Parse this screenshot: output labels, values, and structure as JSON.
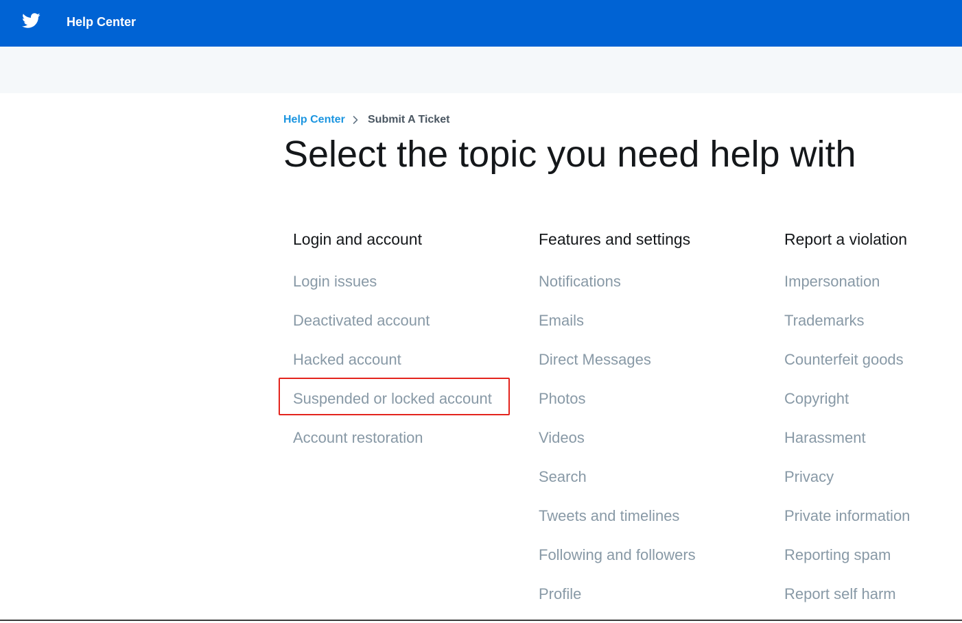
{
  "header": {
    "logo_icon": "twitter-bird-icon",
    "brand_label": "Help Center",
    "background_color": "#0063d4"
  },
  "breadcrumb": {
    "home_label": "Help Center",
    "separator_icon": "chevron-right-icon",
    "current_label": "Submit A Ticket"
  },
  "page": {
    "title": "Select the topic you need help with"
  },
  "topics": [
    {
      "heading": "Login and account",
      "items": [
        "Login issues",
        "Deactivated account",
        "Hacked account",
        "Suspended or locked account",
        "Account restoration"
      ]
    },
    {
      "heading": "Features and settings",
      "items": [
        "Notifications",
        "Emails",
        "Direct Messages",
        "Photos",
        "Videos",
        "Search",
        "Tweets and timelines",
        "Following and followers",
        "Profile"
      ]
    },
    {
      "heading": "Report a violation",
      "items": [
        "Impersonation",
        "Trademarks",
        "Counterfeit goods",
        "Copyright",
        "Harassment",
        "Privacy",
        "Private information",
        "Reporting spam",
        "Report self harm"
      ]
    }
  ],
  "highlight": {
    "target": "Suspended or locked account",
    "color": "#e3231c"
  }
}
